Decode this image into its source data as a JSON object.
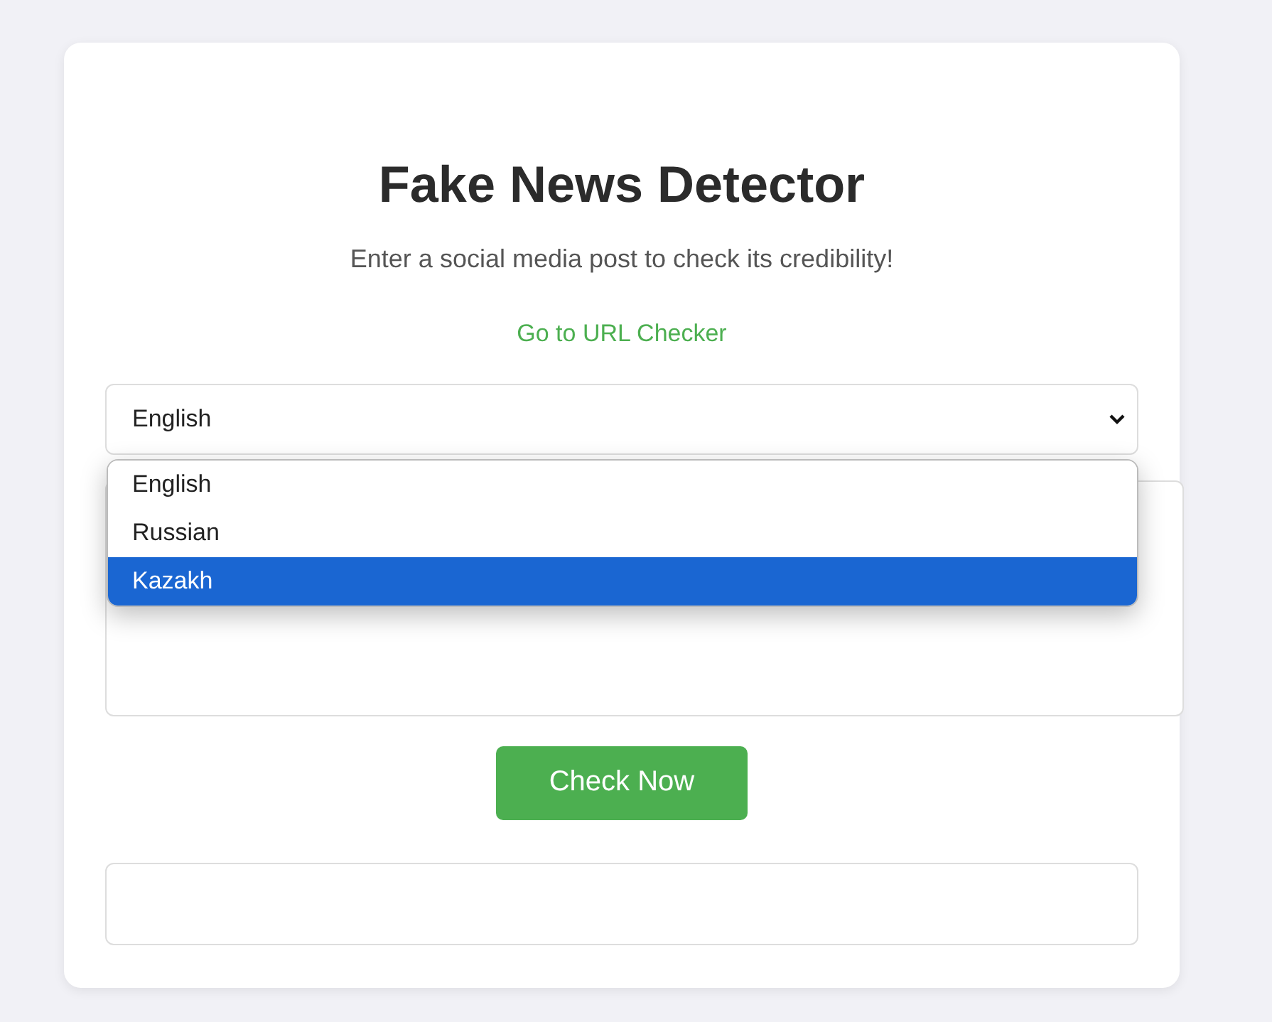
{
  "title": "Fake News Detector",
  "subtitle": "Enter a social media post to check its credibility!",
  "link": "Go to URL Checker",
  "language_select": {
    "value": "English",
    "expanded": true,
    "options": [
      {
        "label": "English",
        "highlighted": false
      },
      {
        "label": "Russian",
        "highlighted": false
      },
      {
        "label": "Kazakh",
        "highlighted": true
      }
    ]
  },
  "button": "Check Now"
}
